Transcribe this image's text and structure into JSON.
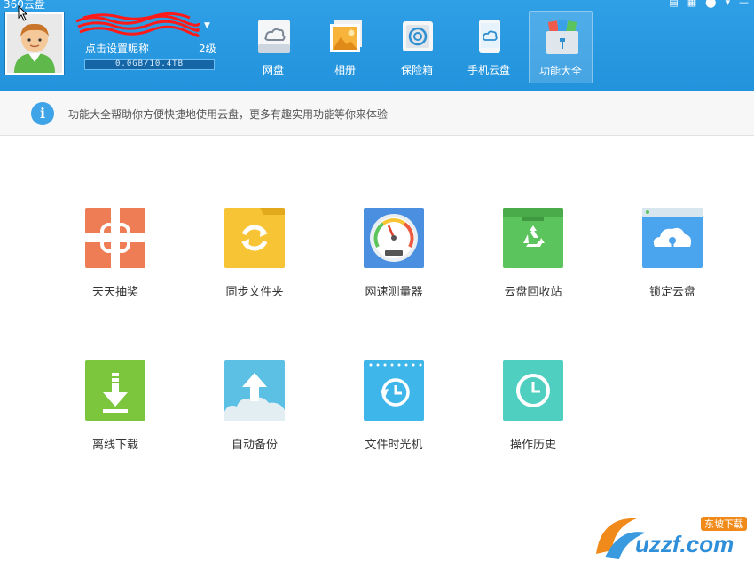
{
  "app": {
    "title": "360云盘"
  },
  "user": {
    "nickname_prompt": "点击设置昵称",
    "level": "2级",
    "storage_text": "0.0GB/10.4TB",
    "storage_used_fraction": 0.0
  },
  "nav": {
    "items": [
      {
        "label": "网盘",
        "icon": "cloud-drive-icon"
      },
      {
        "label": "相册",
        "icon": "photo-album-icon"
      },
      {
        "label": "保险箱",
        "icon": "safe-box-icon"
      },
      {
        "label": "手机云盘",
        "icon": "mobile-cloud-icon"
      },
      {
        "label": "功能大全",
        "icon": "toolbox-icon",
        "active": true
      }
    ]
  },
  "info": {
    "text": "功能大全帮助你方便快捷地使用云盘，更多有趣实用功能等你来体验"
  },
  "features": [
    {
      "label": "天天抽奖",
      "icon": "gift-icon",
      "color": "#ee7d55"
    },
    {
      "label": "同步文件夹",
      "icon": "sync-folder-icon",
      "color": "#f6c434"
    },
    {
      "label": "网速测量器",
      "icon": "speedometer-icon",
      "color": "#4a8fe0"
    },
    {
      "label": "云盘回收站",
      "icon": "recycle-bin-icon",
      "color": "#5cc45c"
    },
    {
      "label": "锁定云盘",
      "icon": "locked-cloud-icon",
      "color": "#4aa4ee"
    },
    {
      "label": "离线下载",
      "icon": "offline-download-icon",
      "color": "#7cc63e"
    },
    {
      "label": "自动备份",
      "icon": "auto-backup-icon",
      "color": "#5bc0e4"
    },
    {
      "label": "文件时光机",
      "icon": "time-machine-icon",
      "color": "#3fb6ea"
    },
    {
      "label": "操作历史",
      "icon": "history-clock-icon",
      "color": "#4ecfc0"
    }
  ],
  "watermark": {
    "text": "uzzf.com",
    "badge": "东坡下载"
  },
  "colors": {
    "header": "#2293dc",
    "info_icon": "#3fa3e8"
  }
}
